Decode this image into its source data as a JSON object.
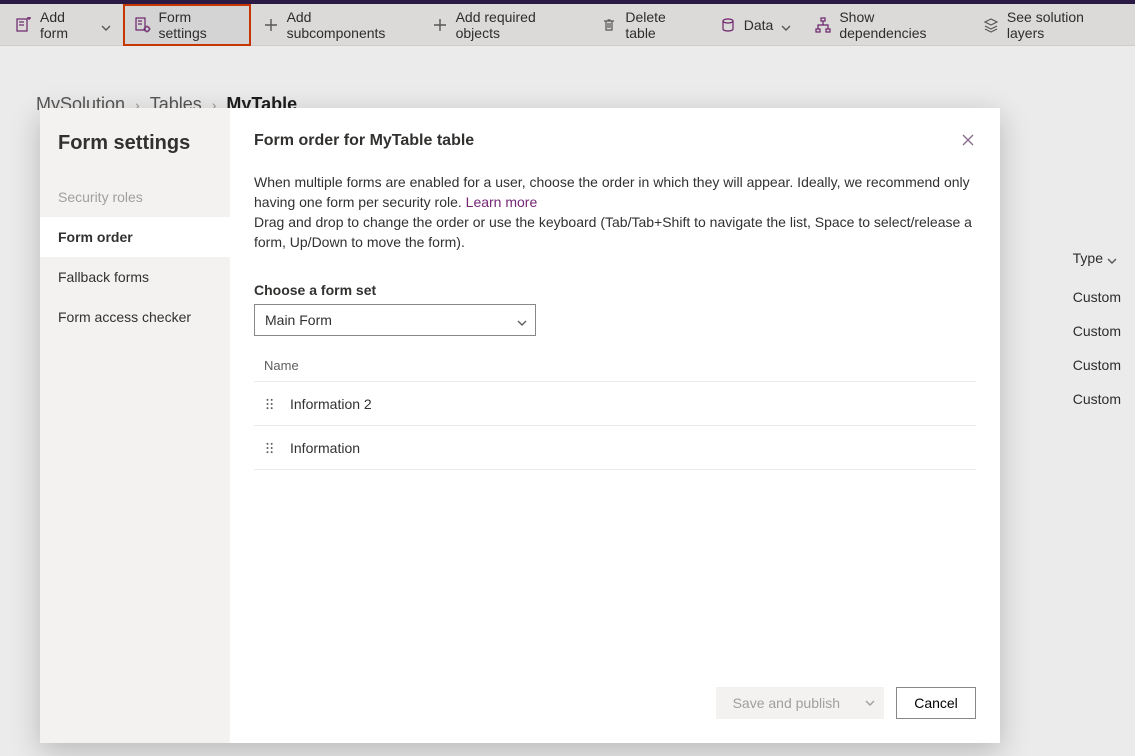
{
  "toolbar": {
    "add_form": "Add form",
    "form_settings": "Form settings",
    "add_subcomponents": "Add subcomponents",
    "add_required_objects": "Add required objects",
    "delete_table": "Delete table",
    "data": "Data",
    "show_dependencies": "Show dependencies",
    "see_solution_layers": "See solution layers"
  },
  "breadcrumb": {
    "items": [
      "MySolution",
      "Tables",
      "MyTable"
    ]
  },
  "bg_table": {
    "type_header": "Type",
    "rows": [
      "Custom",
      "Custom",
      "Custom",
      "Custom"
    ]
  },
  "dialog": {
    "nav_title": "Form settings",
    "nav": {
      "security_roles": "Security roles",
      "form_order": "Form order",
      "fallback_forms": "Fallback forms",
      "form_access_checker": "Form access checker"
    },
    "title": "Form order for MyTable table",
    "desc1": "When multiple forms are enabled for a user, choose the order in which they will appear. Ideally, we recommend only having one form per security role. ",
    "learn_more": "Learn more",
    "desc2": "Drag and drop to change the order or use the keyboard (Tab/Tab+Shift to navigate the list, Space to select/release a form, Up/Down to move the form).",
    "form_set_label": "Choose a form set",
    "form_set_value": "Main Form",
    "list_header": "Name",
    "forms": [
      "Information 2",
      "Information"
    ],
    "save_label": "Save and publish",
    "cancel_label": "Cancel"
  }
}
